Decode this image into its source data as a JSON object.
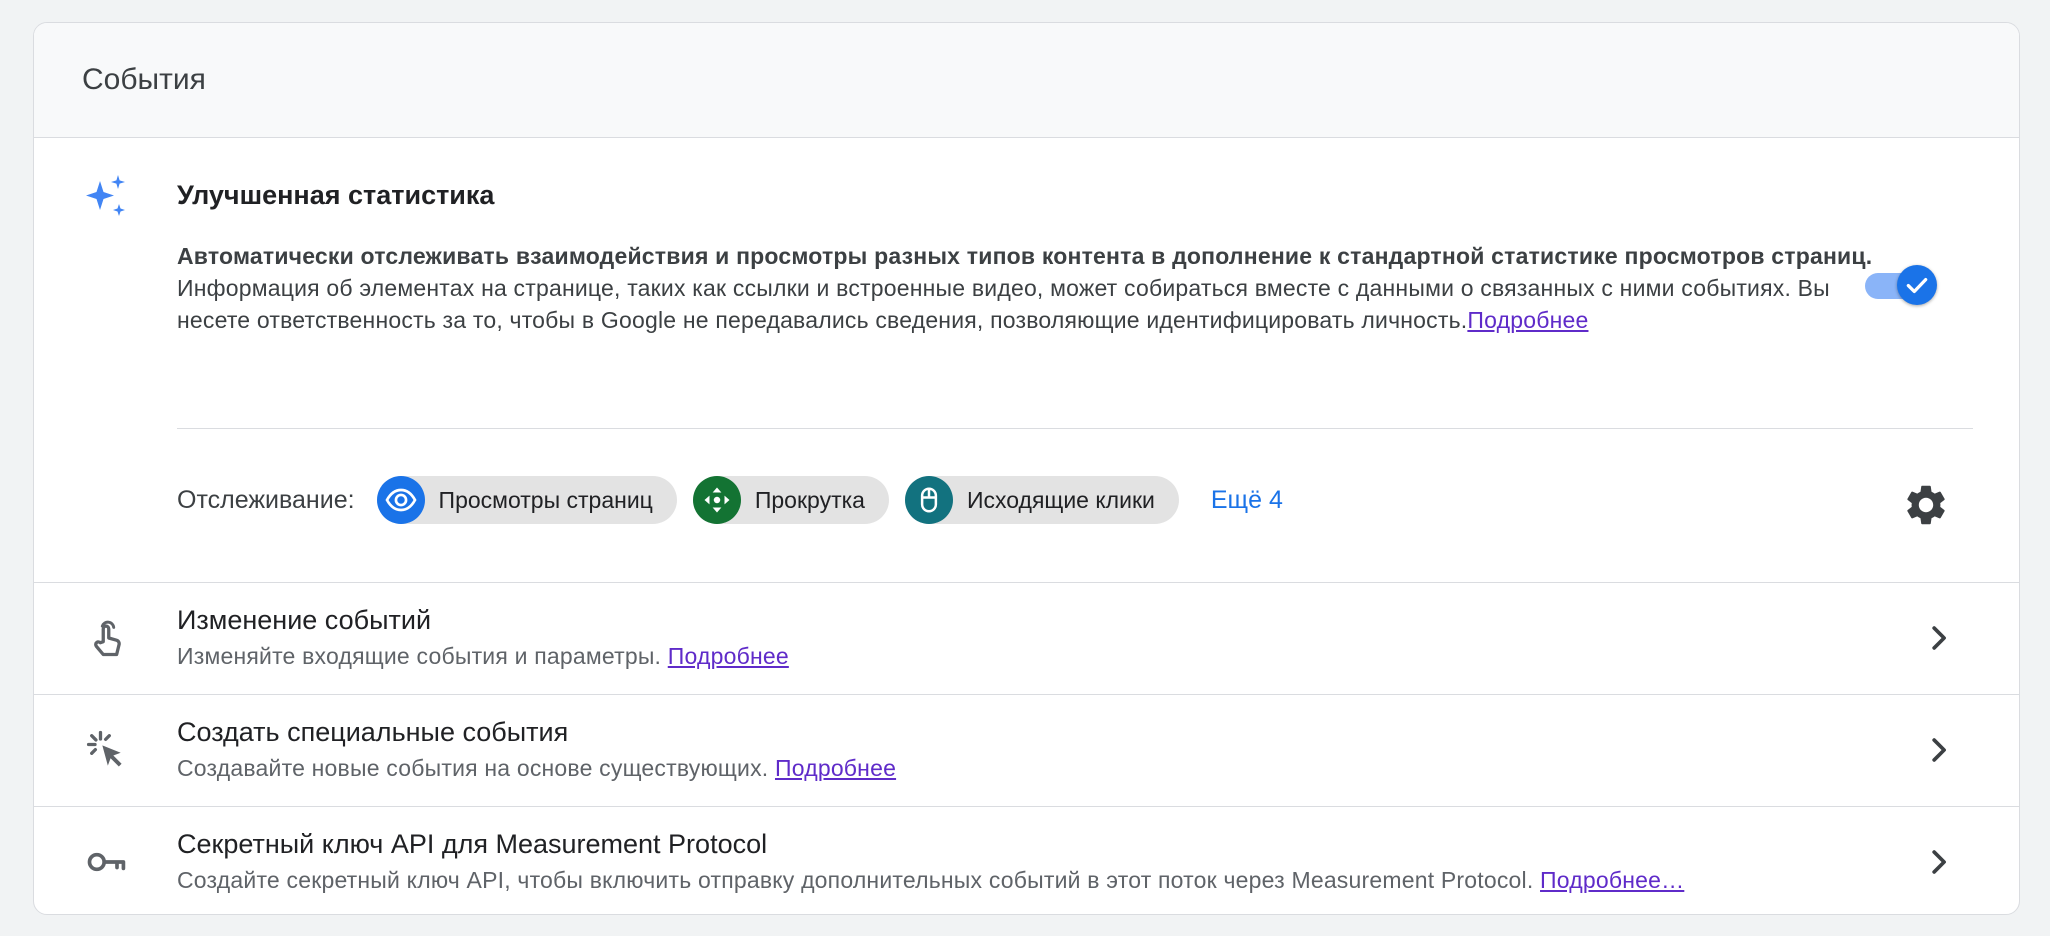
{
  "header": {
    "title": "События"
  },
  "enhanced": {
    "title": "Улучшенная статистика",
    "desc_bold": "Автоматически отслеживать взаимодействия и просмотры разных типов контента в дополнение к стандартной статистике просмотров страниц.",
    "desc_text": "Информация об элементах на странице, таких как ссылки и встроенные видео, может собираться вместе с данными о связанных с ними событиях. Вы несете ответственность за то, чтобы в Google не передавались сведения, позволяющие идентифицировать личность.",
    "learn_more": "Подробнее",
    "toggle_on": true,
    "tracking_label": "Отслеживание:",
    "chips": [
      {
        "label": "Просмотры страниц",
        "icon": "eye-icon",
        "color": "#1a73e8"
      },
      {
        "label": "Прокрутка",
        "icon": "scroll-arrows-icon",
        "color": "#137333"
      },
      {
        "label": "Исходящие клики",
        "icon": "mouse-icon",
        "color": "#12727f"
      }
    ],
    "more": "Ещё 4"
  },
  "rows": [
    {
      "title": "Изменение событий",
      "subtitle": "Изменяйте входящие события и параметры.",
      "link": "Подробнее",
      "icon": "touch-hand-icon"
    },
    {
      "title": "Создать специальные события",
      "subtitle": "Создавайте новые события на основе существующих.",
      "link": "Подробнее",
      "icon": "click-cursor-icon"
    },
    {
      "title": "Секретный ключ API для Measurement Protocol",
      "subtitle": "Создайте секретный ключ API, чтобы включить отправку дополнительных событий в этот поток через Measurement Protocol.",
      "link": "Подробнее…",
      "icon": "key-icon"
    }
  ],
  "colors": {
    "accent": "#1a73e8",
    "link": "#5f2bc9"
  }
}
